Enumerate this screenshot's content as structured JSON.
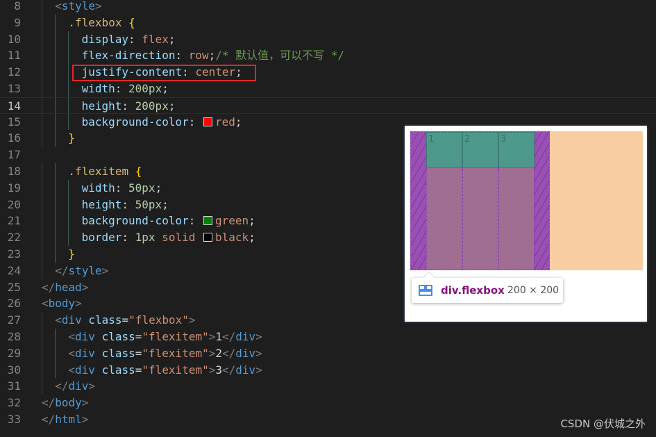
{
  "editor": {
    "lines": [
      {
        "n": "8",
        "indent": 1,
        "tokens": [
          [
            "<",
            "t-punct"
          ],
          [
            "style",
            "t-tag"
          ],
          [
            ">",
            "t-punct"
          ]
        ]
      },
      {
        "n": "9",
        "indent": 2,
        "tokens": [
          [
            ".flexbox ",
            "t-sel"
          ],
          [
            "{",
            "t-brace"
          ]
        ]
      },
      {
        "n": "10",
        "indent": 3,
        "tokens": [
          [
            "display",
            "t-prop"
          ],
          [
            ": ",
            "t-text"
          ],
          [
            "flex",
            "t-val"
          ],
          [
            ";",
            "t-text"
          ]
        ]
      },
      {
        "n": "11",
        "indent": 3,
        "tokens": [
          [
            "flex-direction",
            "t-prop"
          ],
          [
            ": ",
            "t-text"
          ],
          [
            "row",
            "t-val"
          ],
          [
            ";",
            "t-text"
          ],
          [
            "/* 默认值，可以不写 */",
            "t-cmt"
          ]
        ]
      },
      {
        "n": "12",
        "indent": 3,
        "tokens": [
          [
            "justify-content",
            "t-prop"
          ],
          [
            ": ",
            "t-text"
          ],
          [
            "center",
            "t-val"
          ],
          [
            ";",
            "t-text"
          ]
        ]
      },
      {
        "n": "13",
        "indent": 3,
        "tokens": [
          [
            "width",
            "t-prop"
          ],
          [
            ": ",
            "t-text"
          ],
          [
            "200px",
            "t-num"
          ],
          [
            ";",
            "t-text"
          ]
        ]
      },
      {
        "n": "14",
        "indent": 3,
        "current": true,
        "tokens": [
          [
            "height",
            "t-prop"
          ],
          [
            ": ",
            "t-text"
          ],
          [
            "200px",
            "t-num"
          ],
          [
            ";",
            "t-text"
          ]
        ]
      },
      {
        "n": "15",
        "indent": 3,
        "tokens": [
          [
            "background-color",
            "t-prop"
          ],
          [
            ": ",
            "t-text"
          ],
          [
            "#ff0000",
            "swatch"
          ],
          [
            "red",
            "t-val"
          ],
          [
            ";",
            "t-text"
          ]
        ]
      },
      {
        "n": "16",
        "indent": 2,
        "tokens": [
          [
            "}",
            "t-brace"
          ]
        ]
      },
      {
        "n": "17",
        "indent": 0,
        "tokens": []
      },
      {
        "n": "18",
        "indent": 2,
        "tokens": [
          [
            ".flexitem ",
            "t-sel"
          ],
          [
            "{",
            "t-brace"
          ]
        ]
      },
      {
        "n": "19",
        "indent": 3,
        "tokens": [
          [
            "width",
            "t-prop"
          ],
          [
            ": ",
            "t-text"
          ],
          [
            "50px",
            "t-num"
          ],
          [
            ";",
            "t-text"
          ]
        ]
      },
      {
        "n": "20",
        "indent": 3,
        "tokens": [
          [
            "height",
            "t-prop"
          ],
          [
            ": ",
            "t-text"
          ],
          [
            "50px",
            "t-num"
          ],
          [
            ";",
            "t-text"
          ]
        ]
      },
      {
        "n": "21",
        "indent": 3,
        "tokens": [
          [
            "background-color",
            "t-prop"
          ],
          [
            ": ",
            "t-text"
          ],
          [
            "#008000",
            "swatch"
          ],
          [
            "green",
            "t-val"
          ],
          [
            ";",
            "t-text"
          ]
        ]
      },
      {
        "n": "22",
        "indent": 3,
        "tokens": [
          [
            "border",
            "t-prop"
          ],
          [
            ": ",
            "t-text"
          ],
          [
            "1px",
            "t-num"
          ],
          [
            " ",
            "t-text"
          ],
          [
            "solid",
            "t-val"
          ],
          [
            " ",
            "t-text"
          ],
          [
            "#000000",
            "swatch"
          ],
          [
            "black",
            "t-val"
          ],
          [
            ";",
            "t-text"
          ]
        ]
      },
      {
        "n": "23",
        "indent": 2,
        "tokens": [
          [
            "}",
            "t-brace"
          ]
        ]
      },
      {
        "n": "24",
        "indent": 1,
        "tokens": [
          [
            "</",
            "t-punct"
          ],
          [
            "style",
            "t-tag"
          ],
          [
            ">",
            "t-punct"
          ]
        ]
      },
      {
        "n": "25",
        "indent": 0,
        "tokens": [
          [
            "</",
            "t-punct"
          ],
          [
            "head",
            "t-tag"
          ],
          [
            ">",
            "t-punct"
          ]
        ]
      },
      {
        "n": "26",
        "indent": 0,
        "tokens": [
          [
            "<",
            "t-punct"
          ],
          [
            "body",
            "t-tag"
          ],
          [
            ">",
            "t-punct"
          ]
        ]
      },
      {
        "n": "27",
        "indent": 1,
        "tokens": [
          [
            "<",
            "t-punct"
          ],
          [
            "div",
            "t-tag"
          ],
          [
            " ",
            "t-text"
          ],
          [
            "class",
            "t-attr"
          ],
          [
            "=",
            "t-text"
          ],
          [
            "\"flexbox\"",
            "t-str"
          ],
          [
            ">",
            "t-punct"
          ]
        ]
      },
      {
        "n": "28",
        "indent": 2,
        "tokens": [
          [
            "<",
            "t-punct"
          ],
          [
            "div",
            "t-tag"
          ],
          [
            " ",
            "t-text"
          ],
          [
            "class",
            "t-attr"
          ],
          [
            "=",
            "t-text"
          ],
          [
            "\"flexitem\"",
            "t-str"
          ],
          [
            ">",
            "t-punct"
          ],
          [
            "1",
            "t-text"
          ],
          [
            "</",
            "t-punct"
          ],
          [
            "div",
            "t-tag"
          ],
          [
            ">",
            "t-punct"
          ]
        ]
      },
      {
        "n": "29",
        "indent": 2,
        "tokens": [
          [
            "<",
            "t-punct"
          ],
          [
            "div",
            "t-tag"
          ],
          [
            " ",
            "t-text"
          ],
          [
            "class",
            "t-attr"
          ],
          [
            "=",
            "t-text"
          ],
          [
            "\"flexitem\"",
            "t-str"
          ],
          [
            ">",
            "t-punct"
          ],
          [
            "2",
            "t-text"
          ],
          [
            "</",
            "t-punct"
          ],
          [
            "div",
            "t-tag"
          ],
          [
            ">",
            "t-punct"
          ]
        ]
      },
      {
        "n": "30",
        "indent": 2,
        "tokens": [
          [
            "<",
            "t-punct"
          ],
          [
            "div",
            "t-tag"
          ],
          [
            " ",
            "t-text"
          ],
          [
            "class",
            "t-attr"
          ],
          [
            "=",
            "t-text"
          ],
          [
            "\"flexitem\"",
            "t-str"
          ],
          [
            ">",
            "t-punct"
          ],
          [
            "3",
            "t-text"
          ],
          [
            "</",
            "t-punct"
          ],
          [
            "div",
            "t-tag"
          ],
          [
            ">",
            "t-punct"
          ]
        ]
      },
      {
        "n": "31",
        "indent": 1,
        "tokens": [
          [
            "</",
            "t-punct"
          ],
          [
            "div",
            "t-tag"
          ],
          [
            ">",
            "t-punct"
          ]
        ]
      },
      {
        "n": "32",
        "indent": 0,
        "tokens": [
          [
            "</",
            "t-punct"
          ],
          [
            "body",
            "t-tag"
          ],
          [
            ">",
            "t-punct"
          ]
        ]
      },
      {
        "n": "33",
        "indent": 0,
        "tokens": [
          [
            "</",
            "t-punct"
          ],
          [
            "html",
            "t-tag"
          ],
          [
            ">",
            "t-punct"
          ]
        ]
      }
    ],
    "guide_colors": [
      "#404040",
      "#5a5a3c",
      "#3c5a5a"
    ]
  },
  "preview": {
    "items": [
      {
        "label": "1"
      },
      {
        "label": "2"
      },
      {
        "label": "3"
      }
    ],
    "tooltip": {
      "icon": "flex-container-icon",
      "element": "div.flexbox",
      "size": "200 × 200"
    }
  },
  "watermark": "CSDN @伏城之外"
}
